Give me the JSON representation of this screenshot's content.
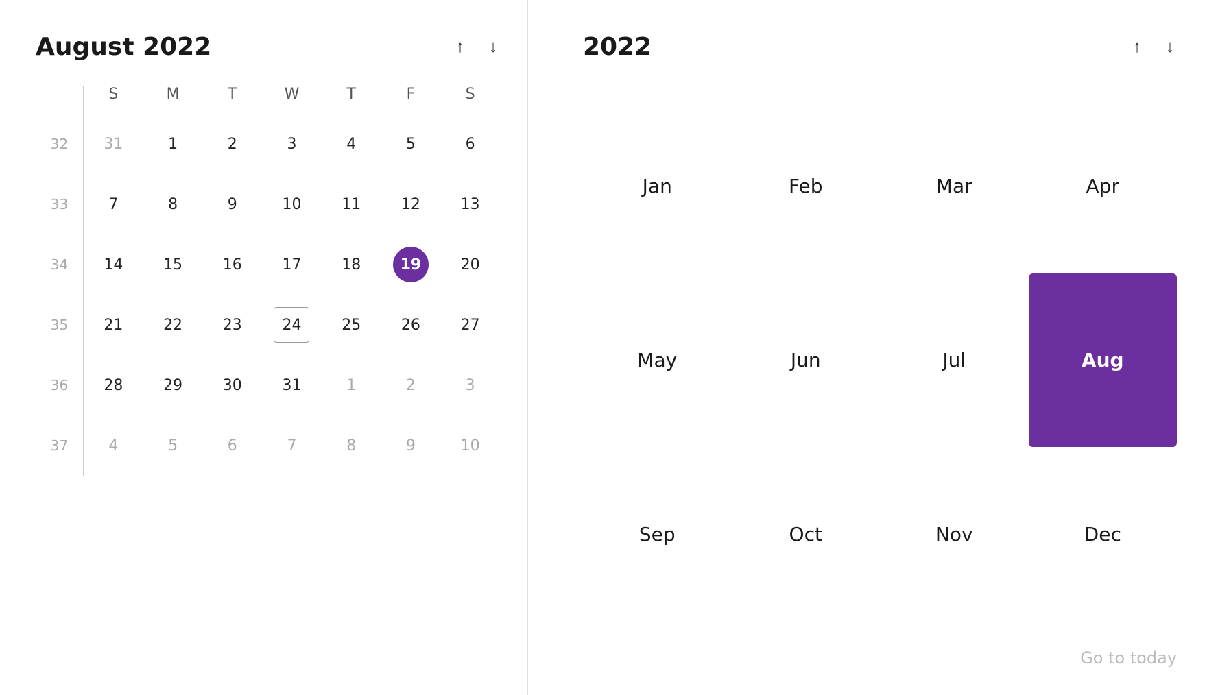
{
  "left": {
    "title": "August 2022",
    "up_arrow": "↑",
    "down_arrow": "↓",
    "day_headers": [
      "S",
      "M",
      "T",
      "W",
      "T",
      "F",
      "S"
    ],
    "weeks": [
      {
        "week_num": "32",
        "days": [
          {
            "label": "31",
            "other": true,
            "selected": false,
            "outlined": false
          },
          {
            "label": "1",
            "other": false,
            "selected": false,
            "outlined": false
          },
          {
            "label": "2",
            "other": false,
            "selected": false,
            "outlined": false
          },
          {
            "label": "3",
            "other": false,
            "selected": false,
            "outlined": false
          },
          {
            "label": "4",
            "other": false,
            "selected": false,
            "outlined": false
          },
          {
            "label": "5",
            "other": false,
            "selected": false,
            "outlined": false
          },
          {
            "label": "6",
            "other": false,
            "selected": false,
            "outlined": false
          }
        ]
      },
      {
        "week_num": "33",
        "days": [
          {
            "label": "7",
            "other": false,
            "selected": false,
            "outlined": false
          },
          {
            "label": "8",
            "other": false,
            "selected": false,
            "outlined": false
          },
          {
            "label": "9",
            "other": false,
            "selected": false,
            "outlined": false
          },
          {
            "label": "10",
            "other": false,
            "selected": false,
            "outlined": false
          },
          {
            "label": "11",
            "other": false,
            "selected": false,
            "outlined": false
          },
          {
            "label": "12",
            "other": false,
            "selected": false,
            "outlined": false
          },
          {
            "label": "13",
            "other": false,
            "selected": false,
            "outlined": false
          }
        ]
      },
      {
        "week_num": "34",
        "days": [
          {
            "label": "14",
            "other": false,
            "selected": false,
            "outlined": false
          },
          {
            "label": "15",
            "other": false,
            "selected": false,
            "outlined": false
          },
          {
            "label": "16",
            "other": false,
            "selected": false,
            "outlined": false
          },
          {
            "label": "17",
            "other": false,
            "selected": false,
            "outlined": false
          },
          {
            "label": "18",
            "other": false,
            "selected": false,
            "outlined": false
          },
          {
            "label": "19",
            "other": false,
            "selected": true,
            "outlined": false
          },
          {
            "label": "20",
            "other": false,
            "selected": false,
            "outlined": false
          }
        ]
      },
      {
        "week_num": "35",
        "days": [
          {
            "label": "21",
            "other": false,
            "selected": false,
            "outlined": false
          },
          {
            "label": "22",
            "other": false,
            "selected": false,
            "outlined": false
          },
          {
            "label": "23",
            "other": false,
            "selected": false,
            "outlined": false
          },
          {
            "label": "24",
            "other": false,
            "selected": false,
            "outlined": true
          },
          {
            "label": "25",
            "other": false,
            "selected": false,
            "outlined": false
          },
          {
            "label": "26",
            "other": false,
            "selected": false,
            "outlined": false
          },
          {
            "label": "27",
            "other": false,
            "selected": false,
            "outlined": false
          }
        ]
      },
      {
        "week_num": "36",
        "days": [
          {
            "label": "28",
            "other": false,
            "selected": false,
            "outlined": false
          },
          {
            "label": "29",
            "other": false,
            "selected": false,
            "outlined": false
          },
          {
            "label": "30",
            "other": false,
            "selected": false,
            "outlined": false
          },
          {
            "label": "31",
            "other": false,
            "selected": false,
            "outlined": false
          },
          {
            "label": "1",
            "other": true,
            "selected": false,
            "outlined": false
          },
          {
            "label": "2",
            "other": true,
            "selected": false,
            "outlined": false
          },
          {
            "label": "3",
            "other": true,
            "selected": false,
            "outlined": false
          }
        ]
      },
      {
        "week_num": "37",
        "days": [
          {
            "label": "4",
            "other": true,
            "selected": false,
            "outlined": false
          },
          {
            "label": "5",
            "other": true,
            "selected": false,
            "outlined": false
          },
          {
            "label": "6",
            "other": true,
            "selected": false,
            "outlined": false
          },
          {
            "label": "7",
            "other": true,
            "selected": false,
            "outlined": false
          },
          {
            "label": "8",
            "other": true,
            "selected": false,
            "outlined": false
          },
          {
            "label": "9",
            "other": true,
            "selected": false,
            "outlined": false
          },
          {
            "label": "10",
            "other": true,
            "selected": false,
            "outlined": false
          }
        ]
      }
    ]
  },
  "right": {
    "title": "2022",
    "up_arrow": "↑",
    "down_arrow": "↓",
    "months": [
      {
        "label": "Jan",
        "active": false
      },
      {
        "label": "Feb",
        "active": false
      },
      {
        "label": "Mar",
        "active": false
      },
      {
        "label": "Apr",
        "active": false
      },
      {
        "label": "May",
        "active": false
      },
      {
        "label": "Jun",
        "active": false
      },
      {
        "label": "Jul",
        "active": false
      },
      {
        "label": "Aug",
        "active": true
      },
      {
        "label": "Sep",
        "active": false
      },
      {
        "label": "Oct",
        "active": false
      },
      {
        "label": "Nov",
        "active": false
      },
      {
        "label": "Dec",
        "active": false
      }
    ],
    "go_to_today": "Go to today"
  }
}
